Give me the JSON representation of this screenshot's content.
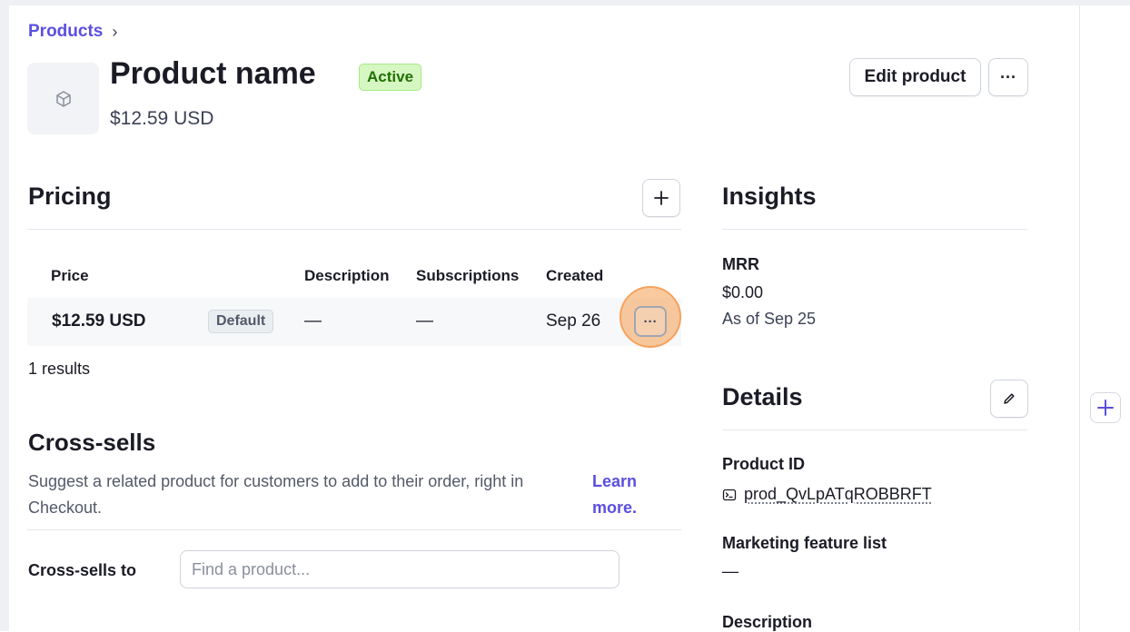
{
  "breadcrumb": {
    "label": "Products",
    "separator": "›"
  },
  "product": {
    "name": "Product name",
    "status": "Active",
    "price": "$12.59 USD",
    "thumbnail_icon": "box-icon"
  },
  "header_actions": {
    "edit_label": "Edit product",
    "more_label": "···"
  },
  "pricing": {
    "title": "Pricing",
    "add_icon": "plus-icon",
    "columns": [
      "Price",
      "Description",
      "Subscriptions",
      "Created"
    ],
    "rows": [
      {
        "price": "$12.59 USD",
        "badge": "Default",
        "description": "—",
        "subscriptions": "—",
        "created": "Sep 26",
        "more": "···"
      }
    ],
    "results": "1 results"
  },
  "cross_sells": {
    "title": "Cross-sells",
    "description": "Suggest a related product for customers to add to their order, right in Checkout.",
    "learn_more": "Learn more.",
    "field_label": "Cross-sells to",
    "placeholder": "Find a product..."
  },
  "insights": {
    "title": "Insights",
    "mrr_label": "MRR",
    "mrr_value": "$0.00",
    "mrr_asof": "As of Sep 25"
  },
  "details": {
    "title": "Details",
    "edit_icon": "pencil-icon",
    "product_id_label": "Product ID",
    "product_id": "prod_QvLpATqROBBRFT",
    "marketing_label": "Marketing feature list",
    "marketing_value": "—",
    "description_label": "Description"
  },
  "colors": {
    "accent": "#5b4fe0",
    "active_bg": "#d7f7c2",
    "active_text": "#217005",
    "highlight": "#f69e50"
  }
}
